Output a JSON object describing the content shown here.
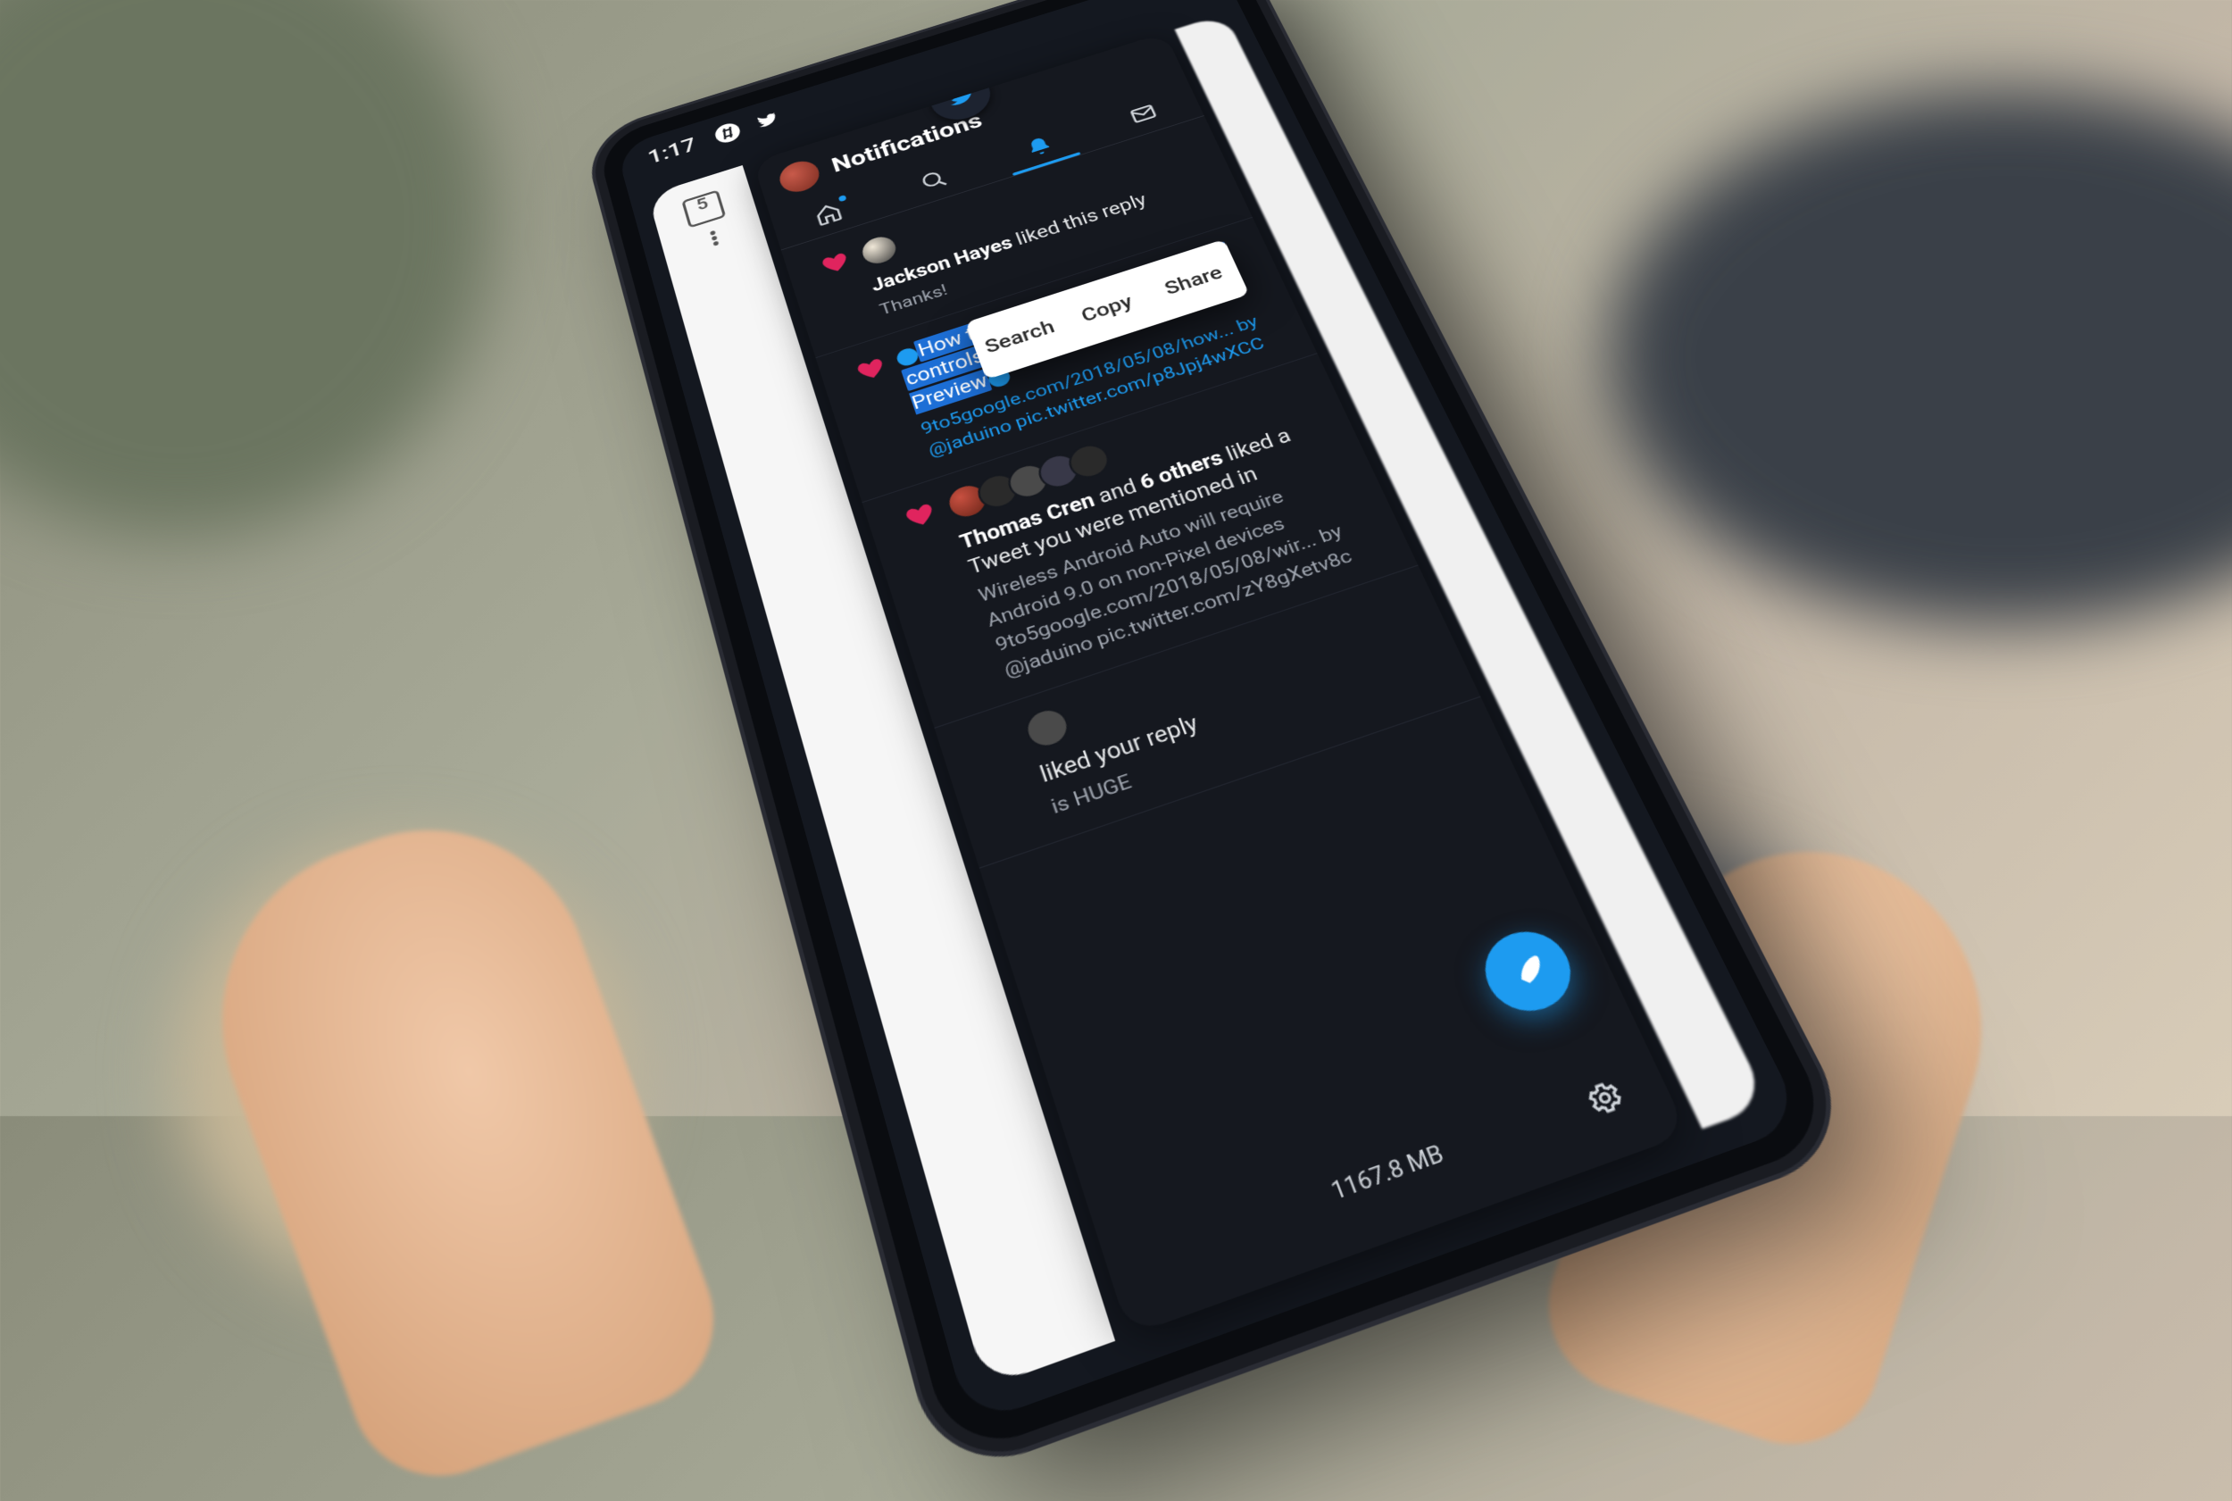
{
  "status_bar": {
    "time": "1:17",
    "icons": [
      "hash-icon",
      "twitter-bird-icon"
    ]
  },
  "browser_card": {
    "tab_count": "5"
  },
  "twitter": {
    "header_title": "Notifications",
    "tabs": [
      "home",
      "search",
      "notifications",
      "messages"
    ],
    "active_tab": "notifications",
    "fab_label": "compose",
    "context_menu": {
      "items": [
        "Search",
        "Copy",
        "Share"
      ]
    },
    "notifications": [
      {
        "action_user": "Jackson Hayes",
        "action_text": "liked this reply",
        "body": "Thanks!"
      },
      {
        "selected_text_line1": "How to enable gesture navigation",
        "selected_text_line2": "controls on Android P Developer Preview",
        "body_text": "9to5google.com/2018/05/08/how... by @jaduino pic.twitter.com/p8Jpj4wXCC"
      },
      {
        "action_user": "Thomas Cren",
        "action_text_prefix": "and",
        "action_count": "6 others",
        "action_text_suffix": "liked a Tweet you were mentioned in",
        "body_text": "Wireless Android Auto will require Android 9.0 on non-Pixel devices 9to5google.com/2018/05/08/wir... by @jaduino pic.twitter.com/zY8gXetv8c"
      },
      {
        "action_text": "liked your reply",
        "body_text": "is HUGE"
      }
    ]
  },
  "system": {
    "memory": "1167.8 MB"
  },
  "colors": {
    "accent": "#1d9bf0",
    "heart": "#e0245e",
    "bg_dark": "#15181f"
  }
}
